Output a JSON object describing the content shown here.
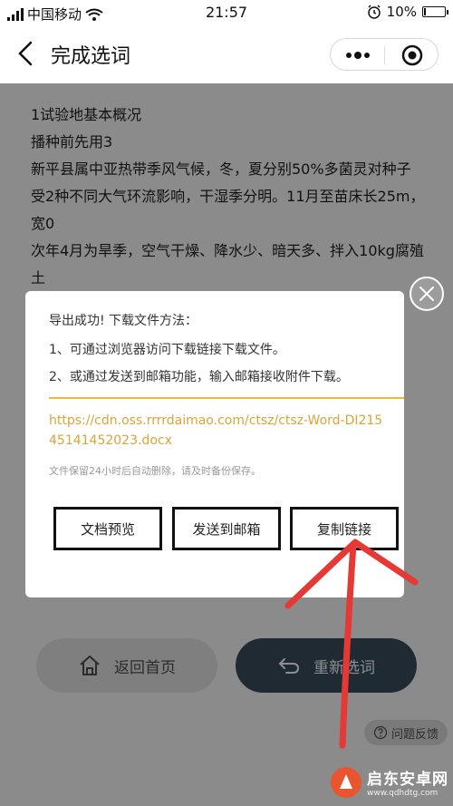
{
  "status_bar": {
    "carrier": "中国移动",
    "time": "21:57",
    "battery": "10%",
    "battery_level": 0.1
  },
  "nav": {
    "title": "完成选词"
  },
  "article": {
    "lines": [
      "1试验地基本概况",
      "播种前先用3",
      "新平县属中亚热带季风气候，冬，夏分别50%多菌灵对种子",
      "受2种不同大气环流影响，干湿季分明。11月至苗床长25m，宽0",
      "次年4月为旱季，空气干燥、降水少、暗天多、拌入10kg腐殖土"
    ]
  },
  "bottom": {
    "home_label": "返回首页",
    "reselect_label": "重新选词",
    "feedback_label": "问题反馈"
  },
  "dialog": {
    "heading": "导出成功! 下载文件方法：",
    "step1": "1、可通过浏览器访问下载链接下载文件。",
    "step2": "2、或通过发送到邮箱功能，输入邮箱接收附件下载。",
    "url": "https://cdn.oss.rrrrdaimao.com/ctsz/ctsz-Word-DI21545141452023.docx",
    "note": "文件保留24小时后自动删除，请及时备份保存。",
    "preview_label": "文档预览",
    "email_label": "发送到邮箱",
    "copy_label": "复制链接"
  },
  "watermark": {
    "title": "启东安卓网",
    "sub": "www.qdhdtg.com"
  },
  "colors": {
    "accent": "#d9a43a",
    "divider": "#e8b84a",
    "annotation": "#e53935"
  }
}
